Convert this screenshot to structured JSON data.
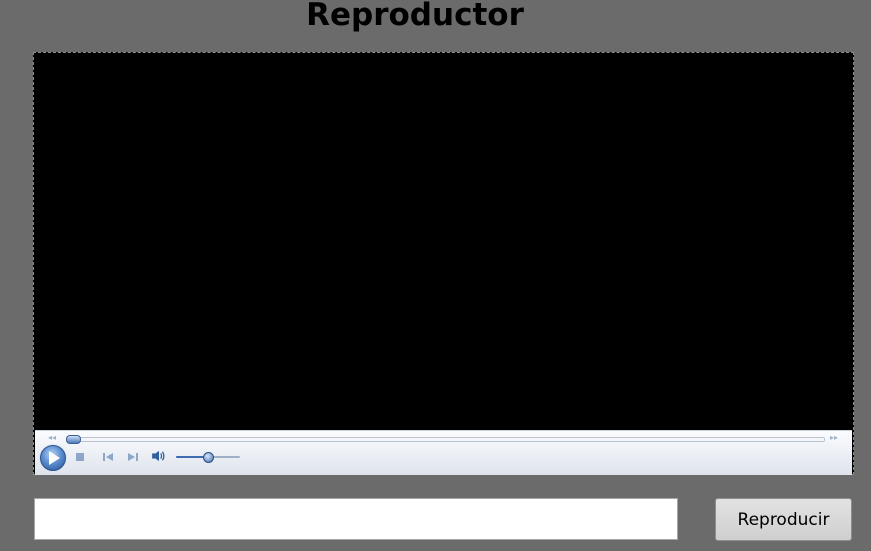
{
  "page": {
    "title": "Reproductor"
  },
  "player": {
    "seek_progress": 0.0,
    "volume_level": 0.5,
    "controls": {
      "play_icon": "play-icon",
      "stop_icon": "stop-icon",
      "previous_icon": "skip-previous-icon",
      "next_icon": "skip-next-icon",
      "volume_icon": "speaker-icon",
      "rewind_icon": "rewind-icon",
      "fast_forward_icon": "fast-forward-icon"
    },
    "accent_color": "#3c6db0"
  },
  "form": {
    "url_value": "",
    "url_placeholder": "",
    "play_label": "Reproducir"
  }
}
